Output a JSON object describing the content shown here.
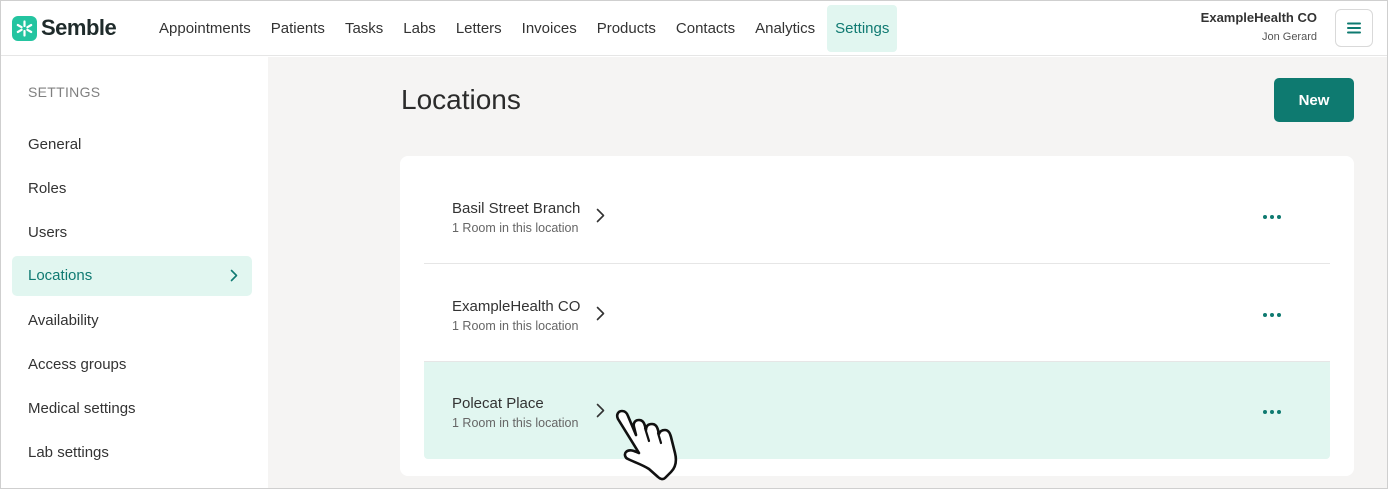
{
  "brand": {
    "name": "Semble",
    "color": "#24c4a0"
  },
  "nav": {
    "items": [
      {
        "label": "Appointments"
      },
      {
        "label": "Patients"
      },
      {
        "label": "Tasks"
      },
      {
        "label": "Labs"
      },
      {
        "label": "Letters"
      },
      {
        "label": "Invoices"
      },
      {
        "label": "Products"
      },
      {
        "label": "Contacts"
      },
      {
        "label": "Analytics"
      },
      {
        "label": "Settings",
        "active": true
      }
    ]
  },
  "account": {
    "org": "ExampleHealth CO",
    "user": "Jon Gerard"
  },
  "sidebar": {
    "heading": "SETTINGS",
    "items": [
      {
        "label": "General"
      },
      {
        "label": "Roles"
      },
      {
        "label": "Users"
      },
      {
        "label": "Locations",
        "active": true
      },
      {
        "label": "Availability"
      },
      {
        "label": "Access groups"
      },
      {
        "label": "Medical settings"
      },
      {
        "label": "Lab settings"
      }
    ]
  },
  "main": {
    "title": "Locations",
    "new_button": "New",
    "locations": [
      {
        "name": "Basil Street Branch",
        "rooms": "1 Room in this location"
      },
      {
        "name": "ExampleHealth CO",
        "rooms": "1 Room in this location"
      },
      {
        "name": "Polecat Place",
        "rooms": "1 Room in this location",
        "hovered": true
      }
    ]
  },
  "icons": {
    "menu": "hamburger-menu-icon",
    "chevron": "chevron-right-icon",
    "more": "more-horizontal-icon",
    "cursor": "hand-pointer-icon"
  },
  "colors": {
    "accent": "#0e7a70",
    "active_bg": "#e1f6f0",
    "main_bg": "#f5f4f3"
  }
}
